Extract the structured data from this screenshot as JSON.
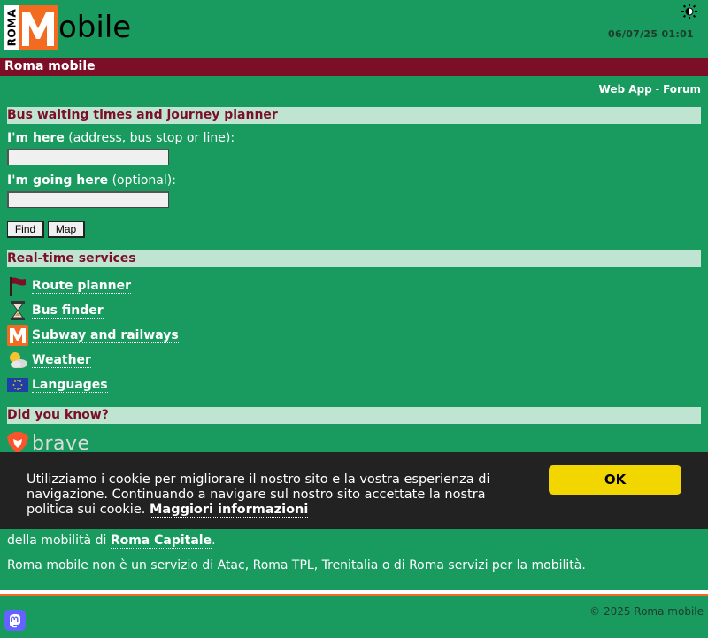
{
  "header": {
    "logo_roma": "ROMA",
    "logo_m": "M",
    "logo_rest": "obile",
    "datetime": "06/07/25 01:01"
  },
  "titlebar": {
    "title": "Roma mobile"
  },
  "toplinks": {
    "webapp": "Web App",
    "separator": "-",
    "forum": "Forum"
  },
  "planner": {
    "heading": "Bus waiting times and journey planner",
    "here_bold": "I'm here",
    "here_rest": " (address, bus stop or line):",
    "here_value": "",
    "going_bold": "I'm going here",
    "going_rest": " (optional):",
    "going_value": "",
    "find_label": "Find",
    "map_label": "Map"
  },
  "services": {
    "heading": "Real-time services",
    "items": [
      {
        "label": "Route planner",
        "icon": "flag-icon"
      },
      {
        "label": "Bus finder",
        "icon": "hourglass-icon"
      },
      {
        "label": "Subway and railways",
        "icon": "metro-icon"
      },
      {
        "label": "Weather",
        "icon": "weather-icon"
      },
      {
        "label": "Languages",
        "icon": "eu-flag-icon"
      }
    ]
  },
  "didyouknow": {
    "heading": "Did you know?",
    "brave": "brave"
  },
  "cookie": {
    "text": "Utilizziamo i cookie per migliorare il nostro sito e la vostra esperienza di navigazione. Continuando a navigare sul nostro sito accettate la nostra politica sui cookie. ",
    "link": "Maggiori informazioni",
    "ok": "OK"
  },
  "behind": {
    "pre": "della mobilità di ",
    "link": "Roma Capitale",
    "post": "."
  },
  "disclaimer": "Roma mobile non è un servizio di Atac, Roma TPL, Trenitalia o di Roma servizi per la mobilità.",
  "footer": {
    "copyright": "© 2025 Roma mobile"
  },
  "colors": {
    "background": "#199b5f",
    "titlebar": "#7c0e28",
    "section": "#bfe5d2",
    "accent": "#f36b21",
    "cookie_ok": "#f1d600"
  }
}
